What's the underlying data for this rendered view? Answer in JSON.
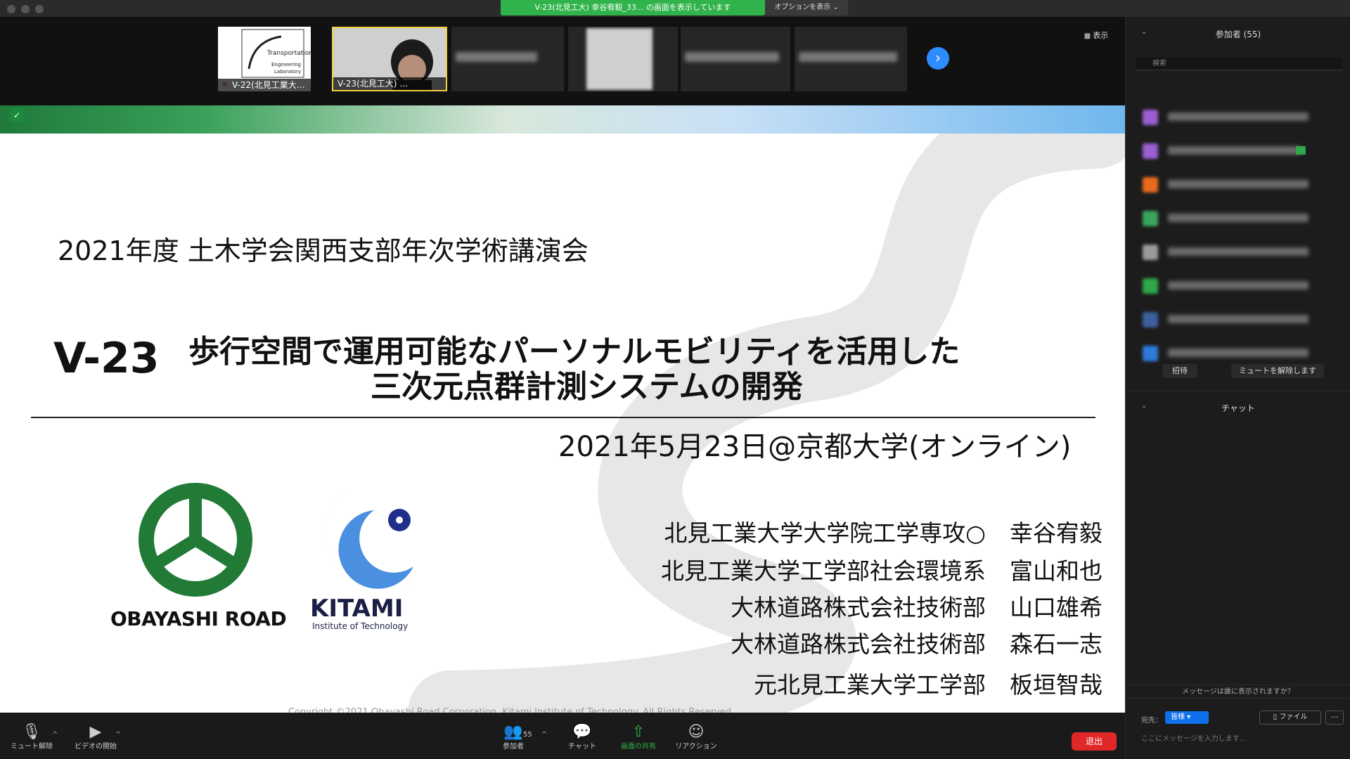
{
  "window": {
    "share_banner": "V-23(北見工大) 幸谷宥毅_33... の画面を表示しています",
    "options_label": "オプションを表示 ⌄"
  },
  "thumbnails": {
    "items": [
      {
        "name": "V-22(北見工業大…"
      },
      {
        "name": "V-23(北見工大) …"
      }
    ],
    "view_label": "表示",
    "logo_text": "Transportation Engineering Laboratory"
  },
  "slide": {
    "conference": "2021年度 土木学会関西支部年次学術講演会",
    "code": "V-23",
    "title_line1": "歩行空間で運用可能なパーソナルモビリティを活用した",
    "title_line2": "三次元点群計測システムの開発",
    "date": "2021年5月23日@京都大学(オンライン)",
    "authors": [
      {
        "affiliation": "北見工業大学大学院工学専攻○",
        "name": "幸谷宥毅"
      },
      {
        "affiliation": "北見工業大学工学部社会環境系",
        "name": "富山和也"
      },
      {
        "affiliation": "大林道路株式会社技術部",
        "name": "山口雄希"
      },
      {
        "affiliation": "大林道路株式会社技術部",
        "name": "森石一志"
      },
      {
        "affiliation": "元北見工業大学工学部",
        "name": "板垣智哉"
      }
    ],
    "logo_left": "OBAYASHI ROAD",
    "logo_right": "KITAMI",
    "logo_right_sub": "Institute of Technology",
    "copyright": "Copyright ©2021 Obayashi Road Corporation, Kitami Institute of Technology. All Rights Reserved."
  },
  "participants_panel": {
    "title": "参加者 (55)",
    "search_placeholder": "検索",
    "invite_label": "招待",
    "unmute_all_label": "ミュートを解除します",
    "avatar_colors": [
      "#9a5fd0",
      "#9a5fd0",
      "#e86a1e",
      "#3aa55a",
      "#9a9a9a",
      "#2fa84a",
      "#3d5f9a",
      "#2d7ad8"
    ]
  },
  "chat_panel": {
    "title": "チャット",
    "visibility_notice": "メッセージは誰に表示されますか？",
    "to_label": "宛先：",
    "to_value": "皆様",
    "file_label": "ファイル",
    "more_label": "···",
    "input_placeholder": "ここにメッセージを入力します..."
  },
  "toolbar": {
    "unmute_label": "ミュート解除",
    "start_video_label": "ビデオの開始",
    "participants_label": "参加者",
    "participants_count": "55",
    "chat_label": "チャット",
    "share_screen_label": "画面の共有",
    "reactions_label": "リアクション",
    "leave_label": "退出"
  }
}
